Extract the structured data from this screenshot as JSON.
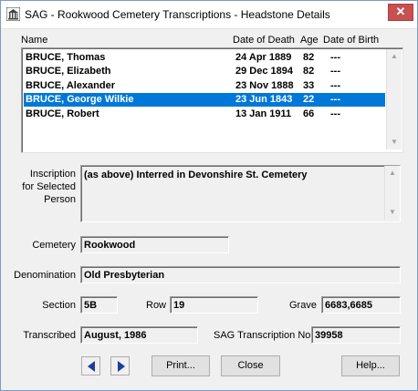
{
  "window": {
    "title": "SAG - Rookwood Cemetery Transcriptions - Headstone Details",
    "close_glyph": "✕"
  },
  "list": {
    "headers": {
      "name": "Name",
      "date_of_death": "Date of Death",
      "age": "Age",
      "date_of_birth": "Date of Birth"
    },
    "rows": [
      {
        "name": "BRUCE, Thomas",
        "date_of_death": "24 Apr 1889",
        "age": "82",
        "date_of_birth": "---",
        "selected": false
      },
      {
        "name": "BRUCE, Elizabeth",
        "date_of_death": "29 Dec 1894",
        "age": "82",
        "date_of_birth": "---",
        "selected": false
      },
      {
        "name": "BRUCE, Alexander",
        "date_of_death": "23 Nov 1888",
        "age": "33",
        "date_of_birth": "---",
        "selected": false
      },
      {
        "name": "BRUCE, George Wilkie",
        "date_of_death": "23 Jun 1843",
        "age": "22",
        "date_of_birth": "---",
        "selected": true
      },
      {
        "name": "BRUCE, Robert",
        "date_of_death": "13 Jan 1911",
        "age": "66",
        "date_of_birth": "---",
        "selected": false
      }
    ]
  },
  "details": {
    "inscription_label_1": "Inscription",
    "inscription_label_2": "for Selected",
    "inscription_label_3": "Person",
    "inscription": "(as above) Interred in Devonshire St. Cemetery",
    "cemetery_label": "Cemetery",
    "cemetery": "Rookwood",
    "denomination_label": "Denomination",
    "denomination": "Old Presbyterian",
    "section_label": "Section",
    "section": "5B",
    "row_label": "Row",
    "row": "19",
    "grave_label": "Grave",
    "grave": "6683,6685",
    "transcribed_label": "Transcribed",
    "transcribed": "August, 1986",
    "transcription_no_label": "SAG Transcription No",
    "transcription_no": "39958"
  },
  "buttons": {
    "print": "Print...",
    "close": "Close",
    "help": "Help..."
  },
  "colors": {
    "selection": "#0078d7",
    "nav_arrow": "#1e3c9c",
    "close_button": "#c75050"
  }
}
